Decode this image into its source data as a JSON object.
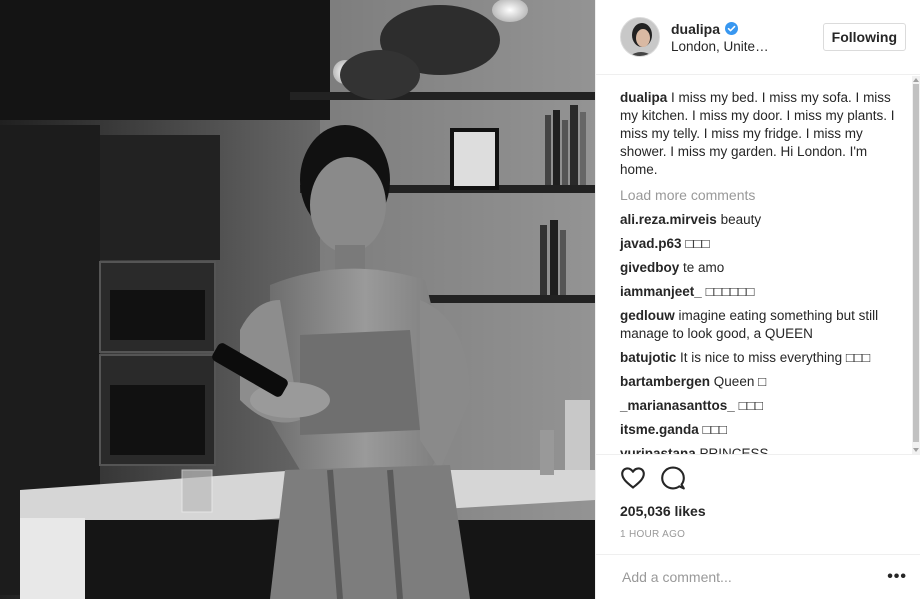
{
  "post": {
    "username": "dualipa",
    "location": "London, United Kingdom",
    "follow_label": "Following",
    "verified_icon": "verified-badge-icon",
    "accent_color": "#3897f0"
  },
  "caption": {
    "username": "dualipa",
    "text": "I miss my bed. I miss my sofa. I miss my kitchen. I miss my door. I miss my plants. I miss my telly. I miss my fridge. I miss my shower. I miss my garden. Hi London. I'm home."
  },
  "load_more_label": "Load more comments",
  "comments": [
    {
      "user": "ali.reza.mirveis",
      "text": "beauty"
    },
    {
      "user": "javad.p63",
      "text": "□□□"
    },
    {
      "user": "givedboy",
      "text": "te amo"
    },
    {
      "user": "iammanjeet_",
      "text": "□□□□□□"
    },
    {
      "user": "gedlouw",
      "text": "imagine eating something but still manage to look good, a QUEEN"
    },
    {
      "user": "batujotic",
      "text": "It is nice to miss everything □□□"
    },
    {
      "user": "bartambergen",
      "text": "Queen □"
    },
    {
      "user": "_marianasanttos_",
      "text": "□□□"
    },
    {
      "user": "itsme.ganda",
      "text": "□□□"
    },
    {
      "user": "yuripastana",
      "text": "PRINCESS"
    }
  ],
  "actions": {
    "like_icon": "heart-icon",
    "comment_icon": "comment-bubble-icon",
    "likes_text": "205,036 likes",
    "timestamp": "1 HOUR AGO"
  },
  "add_comment": {
    "placeholder": "Add a comment...",
    "more_label": "•••"
  }
}
